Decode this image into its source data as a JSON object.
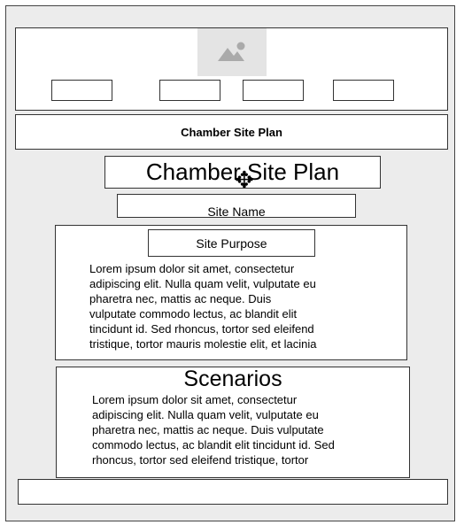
{
  "header": {
    "image_icon": "image-placeholder-icon",
    "nav_buttons": [
      "",
      "",
      "",
      ""
    ]
  },
  "title_bar": {
    "text": "Chamber Site Plan"
  },
  "main": {
    "big_title": "Chamber Site Plan",
    "site_name": "Site Name",
    "purpose": {
      "title": "Site Purpose",
      "text": "Lorem ipsum dolor sit amet, consectetur\nadipiscing elit. Nulla quam velit, vulputate eu\npharetra nec, mattis ac neque. Duis\nvulputate commodo lectus, ac blandit elit\ntincidunt id. Sed rhoncus, tortor sed eleifend\ntristique, tortor mauris molestie elit, et lacinia"
    },
    "scenarios": {
      "title": "Scenarios",
      "text": "Lorem ipsum dolor sit amet, consectetur\nadipiscing elit. Nulla quam velit, vulputate eu\npharetra nec, mattis ac neque. Duis vulputate\ncommodo lectus, ac blandit elit tincidunt id. Sed\nrhoncus, tortor sed eleifend tristique, tortor"
    }
  },
  "colors": {
    "frame_bg": "#ececec",
    "panel_bg": "#ffffff",
    "border": "#333333",
    "placeholder": "#e4e4e4"
  }
}
